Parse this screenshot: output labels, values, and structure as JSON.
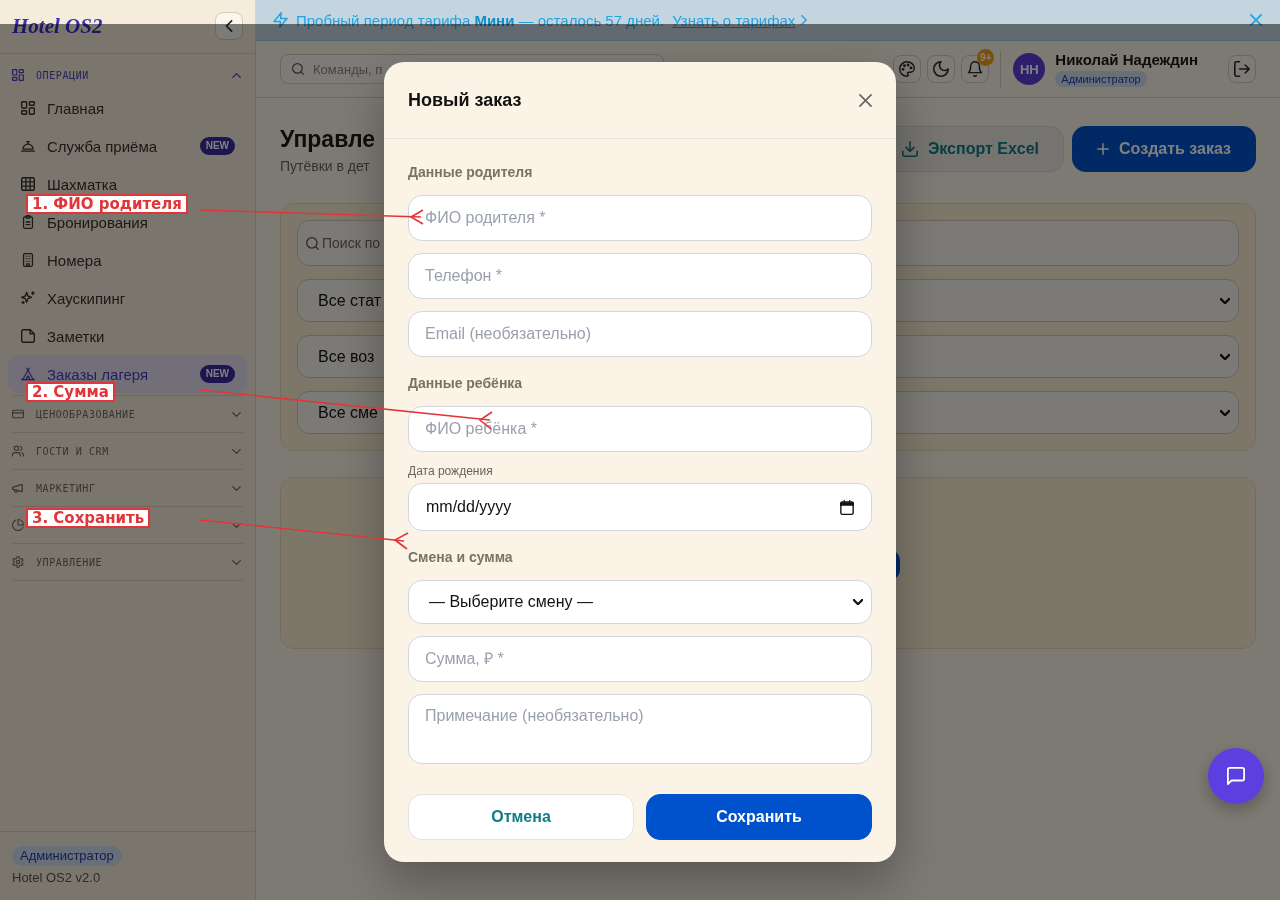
{
  "sidebar": {
    "logo": "Hotel OS2",
    "sections": [
      {
        "label": "ОПЕРАЦИИ",
        "expanded": true,
        "items": [
          {
            "label": "Главная",
            "selected": false
          },
          {
            "label": "Служба приёма",
            "selected": false,
            "badge": "NEW"
          },
          {
            "label": "Шахматка",
            "selected": false
          },
          {
            "label": "Бронирования",
            "selected": false
          },
          {
            "label": "Номера",
            "selected": false
          },
          {
            "label": "Хаускипинг",
            "selected": false
          },
          {
            "label": "Заметки",
            "selected": false
          },
          {
            "label": "Заказы лагеря",
            "selected": true,
            "badge": "NEW"
          }
        ]
      },
      {
        "label": "ЦЕНООБРАЗОВАНИЕ",
        "expanded": false
      },
      {
        "label": "ГОСТИ И CRM",
        "expanded": false
      },
      {
        "label": "МАРКЕТИНГ",
        "expanded": false
      },
      {
        "expanded": false
      },
      {
        "label": "УПРАВЛЕНИЕ",
        "expanded": false
      }
    ],
    "footer": {
      "role": "Администратор",
      "version": "Hotel OS2 v2.0"
    }
  },
  "trial_banner": {
    "message": "Пробный период тарифа **Мини** — осталось 57 дней.",
    "link": "Узнать о тарифах"
  },
  "top_bar": {
    "search": {
      "placeholder": "Команды, п"
    },
    "notifications": {
      "badge": "9+"
    },
    "user": {
      "initials": "НН",
      "name": "Николай Надеждин",
      "role": "Администратор"
    }
  },
  "page": {
    "title": "Управле",
    "subtitle": "Путёвки в дет",
    "actions": [
      {
        "label": "Экспорт Excel",
        "kind": "secondary"
      },
      {
        "label": "Создать заказ",
        "kind": "primary"
      }
    ],
    "filters": {
      "search": {
        "placeholder": "Поиск по"
      },
      "selects": [
        {
          "value": "Все стат"
        },
        {
          "value": "Все воз"
        },
        {
          "value": "Все сме"
        }
      ]
    },
    "orders_panel": {
      "action_button": true
    }
  },
  "modal": {
    "title": "Новый заказ",
    "sections": [
      {
        "heading": "Данные родителя",
        "fields": [
          {
            "kind": "text",
            "placeholder": "ФИО родителя *"
          },
          {
            "kind": "text",
            "placeholder": "Телефон *"
          },
          {
            "kind": "text",
            "placeholder": "Email (необязательно)"
          }
        ]
      },
      {
        "heading": "Данные ребёнка",
        "fields": [
          {
            "kind": "text",
            "placeholder": "ФИО ребёнка *"
          },
          {
            "kind": "date",
            "label": "Дата рождения",
            "placeholder": "mm/dd/yyyy"
          }
        ]
      },
      {
        "heading": "Смена и сумма",
        "fields": [
          {
            "kind": "select",
            "value": "— Выберите смену —"
          },
          {
            "kind": "text",
            "placeholder": "Сумма, ₽ *"
          },
          {
            "kind": "textarea",
            "placeholder": "Примечание (необязательно)"
          }
        ]
      }
    ],
    "buttons": [
      {
        "label": "Отмена",
        "kind": "secondary"
      },
      {
        "label": "Сохранить",
        "kind": "primary"
      }
    ]
  },
  "annotations": [
    {
      "label": "1. ФИО родителя"
    },
    {
      "label": "2. Сумма"
    },
    {
      "label": "3. Сохранить"
    }
  ]
}
